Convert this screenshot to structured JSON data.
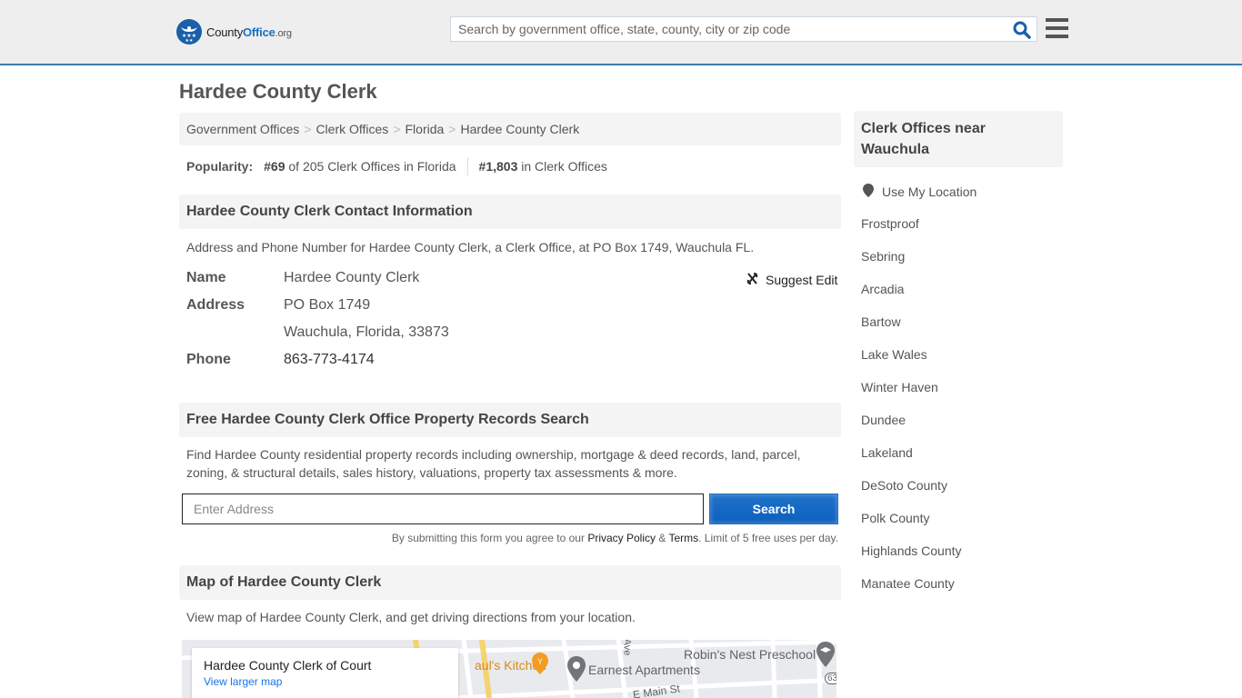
{
  "header": {
    "logo": {
      "county": "County",
      "office": "Office",
      "org": ".org"
    },
    "search_placeholder": "Search by government office, state, county, city or zip code",
    "accent_color": "#3a7cae"
  },
  "page_title": "Hardee County Clerk",
  "breadcrumb": [
    "Government Offices",
    "Clerk Offices",
    "Florida",
    "Hardee County Clerk"
  ],
  "popularity": {
    "label": "Popularity:",
    "state_rank": "#69",
    "state_text": "of 205 Clerk Offices in Florida",
    "national_rank": "#1,803",
    "national_text": "in Clerk Offices"
  },
  "contact": {
    "heading": "Hardee County Clerk Contact Information",
    "description": "Address and Phone Number for Hardee County Clerk, a Clerk Office, at PO Box 1749, Wauchula FL.",
    "suggest_edit": "Suggest Edit",
    "rows": {
      "name_label": "Name",
      "name_value": "Hardee County Clerk",
      "address_label": "Address",
      "address_line1": "PO Box 1749",
      "address_line2": "Wauchula, Florida, 33873",
      "phone_label": "Phone",
      "phone_value": "863-773-4174"
    }
  },
  "property": {
    "heading": "Free Hardee County Clerk Office Property Records Search",
    "description": "Find Hardee County residential property records including ownership, mortgage & deed records, land, parcel, zoning, & structural details, sales history, valuations, property tax assessments & more.",
    "input_placeholder": "Enter Address",
    "search_label": "Search",
    "disclaimer_prefix": "By submitting this form you agree to our ",
    "privacy_link": "Privacy Policy",
    "amp": " & ",
    "terms_link": "Terms",
    "disclaimer_suffix": ". Limit of 5 free uses per day."
  },
  "map": {
    "heading": "Map of Hardee County Clerk",
    "description_prefix": "View map of Hardee County Clerk, and ",
    "directions_link": "get driving directions from your location",
    "description_suffix": ".",
    "card_title": "Hardee County Clerk of Court",
    "card_link": "View larger map",
    "labels": {
      "kitchen": "aul's Kitchen",
      "apartments": "Earnest Apartments",
      "preschool": "Robin's Nest Preschool",
      "street": "E Main St",
      "ave": "Ave",
      "route": "63"
    }
  },
  "sidebar": {
    "heading": "Clerk Offices near Wauchula",
    "use_location": "Use My Location",
    "links": [
      "Frostproof",
      "Sebring",
      "Arcadia",
      "Bartow",
      "Lake Wales",
      "Winter Haven",
      "Dundee",
      "Lakeland",
      "DeSoto County",
      "Polk County",
      "Highlands County",
      "Manatee County"
    ]
  }
}
